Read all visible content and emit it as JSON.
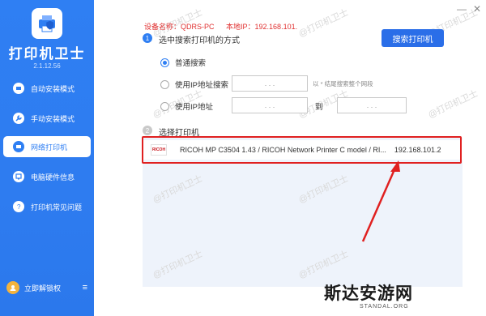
{
  "sidebar": {
    "title": "打印机卫士",
    "version": "2.1.12.56",
    "items": [
      {
        "label": "自动安装模式",
        "icon": "auto-install-icon"
      },
      {
        "label": "手动安装模式",
        "icon": "wrench-icon"
      },
      {
        "label": "网络打印机",
        "icon": "network-printer-icon"
      },
      {
        "label": "电脑硬件信息",
        "icon": "hardware-info-icon"
      },
      {
        "label": "打印机常见问题",
        "icon": "help-icon"
      }
    ],
    "active_index": 2,
    "vip_label": "立即解锁权",
    "menu_icon": "≡"
  },
  "header": {
    "device_name": "设备名称：QDRS-PC",
    "local_ip": "本地IP：192.168.101.",
    "window_controls": [
      "—",
      "✕"
    ]
  },
  "step1": {
    "number": "1",
    "label": "选中搜索打印机的方式",
    "search_button": "搜索打印机",
    "options": [
      {
        "label": "普通搜索",
        "checked": true
      },
      {
        "label": "使用IP地址搜索",
        "checked": false
      },
      {
        "label": "使用IP地址",
        "checked": false
      }
    ],
    "ip_placeholder": ".          .          .",
    "suffix_hint": "以 * 结尾搜索整个网段",
    "to_label": "到"
  },
  "step2": {
    "number": "2",
    "label": "选择打印机",
    "printers": [
      {
        "brand": "RICOH",
        "name": "RICOH MP C3504 1.43 / RICOH Network Printer C model / RI...",
        "ip": "192.168.101.2"
      }
    ]
  },
  "watermark": "@打印机卫士",
  "brand": {
    "name": "斯达安游网",
    "url": "STANDAL.ORG"
  },
  "colors": {
    "sidebar_blue": "#2f7ff3",
    "button_blue": "#2a6ee8",
    "highlight_red": "#e02020",
    "panel_bg": "#eef3fb"
  }
}
